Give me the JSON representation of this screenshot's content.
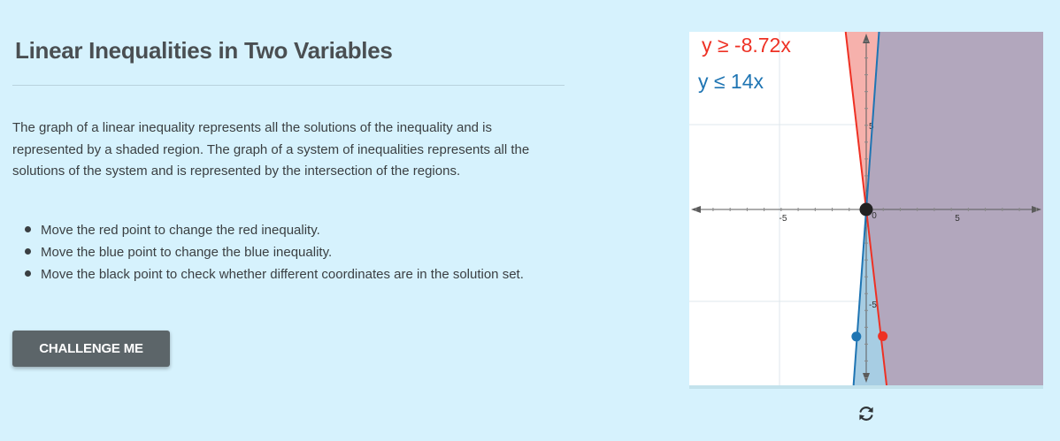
{
  "page": {
    "title": "Linear Inequalities in Two Variables",
    "intro": "The graph of a linear inequality represents all the solutions of the inequality and is represented by a shaded region. The graph of a system of inequalities represents all the solutions of the system and is represented by the intersection of the regions.",
    "instructions": [
      "Move the red point to change the red inequality.",
      "Move the blue point to change the blue inequality.",
      "Move the black point to check whether different coordinates are in the solution set."
    ],
    "challenge_button": "CHALLENGE ME"
  },
  "graph": {
    "red_inequality": "y ≥ -8.72x",
    "blue_inequality": "y ≤ 14x",
    "red_slope": -8.72,
    "blue_slope": 14,
    "x_range": [
      -10.4,
      10.4
    ],
    "y_range": [
      -10.5,
      10.5
    ],
    "tick_labels": {
      "x_neg": "-5",
      "x_zero": "0",
      "x_pos": "5",
      "y_pos": "5",
      "y_neg": "-5"
    },
    "red_point": [
      0.97,
      -7.53
    ],
    "blue_point": [
      -0.58,
      -7.55
    ],
    "black_point": [
      0,
      0
    ],
    "colors": {
      "red": "#ee3124",
      "blue": "#1f75b3",
      "red_fill": "#f6b1ac",
      "blue_fill": "#a7cde3",
      "overlap_fill": "#b2a7bd",
      "point": "#222222"
    },
    "reset_icon": "refresh-icon"
  }
}
